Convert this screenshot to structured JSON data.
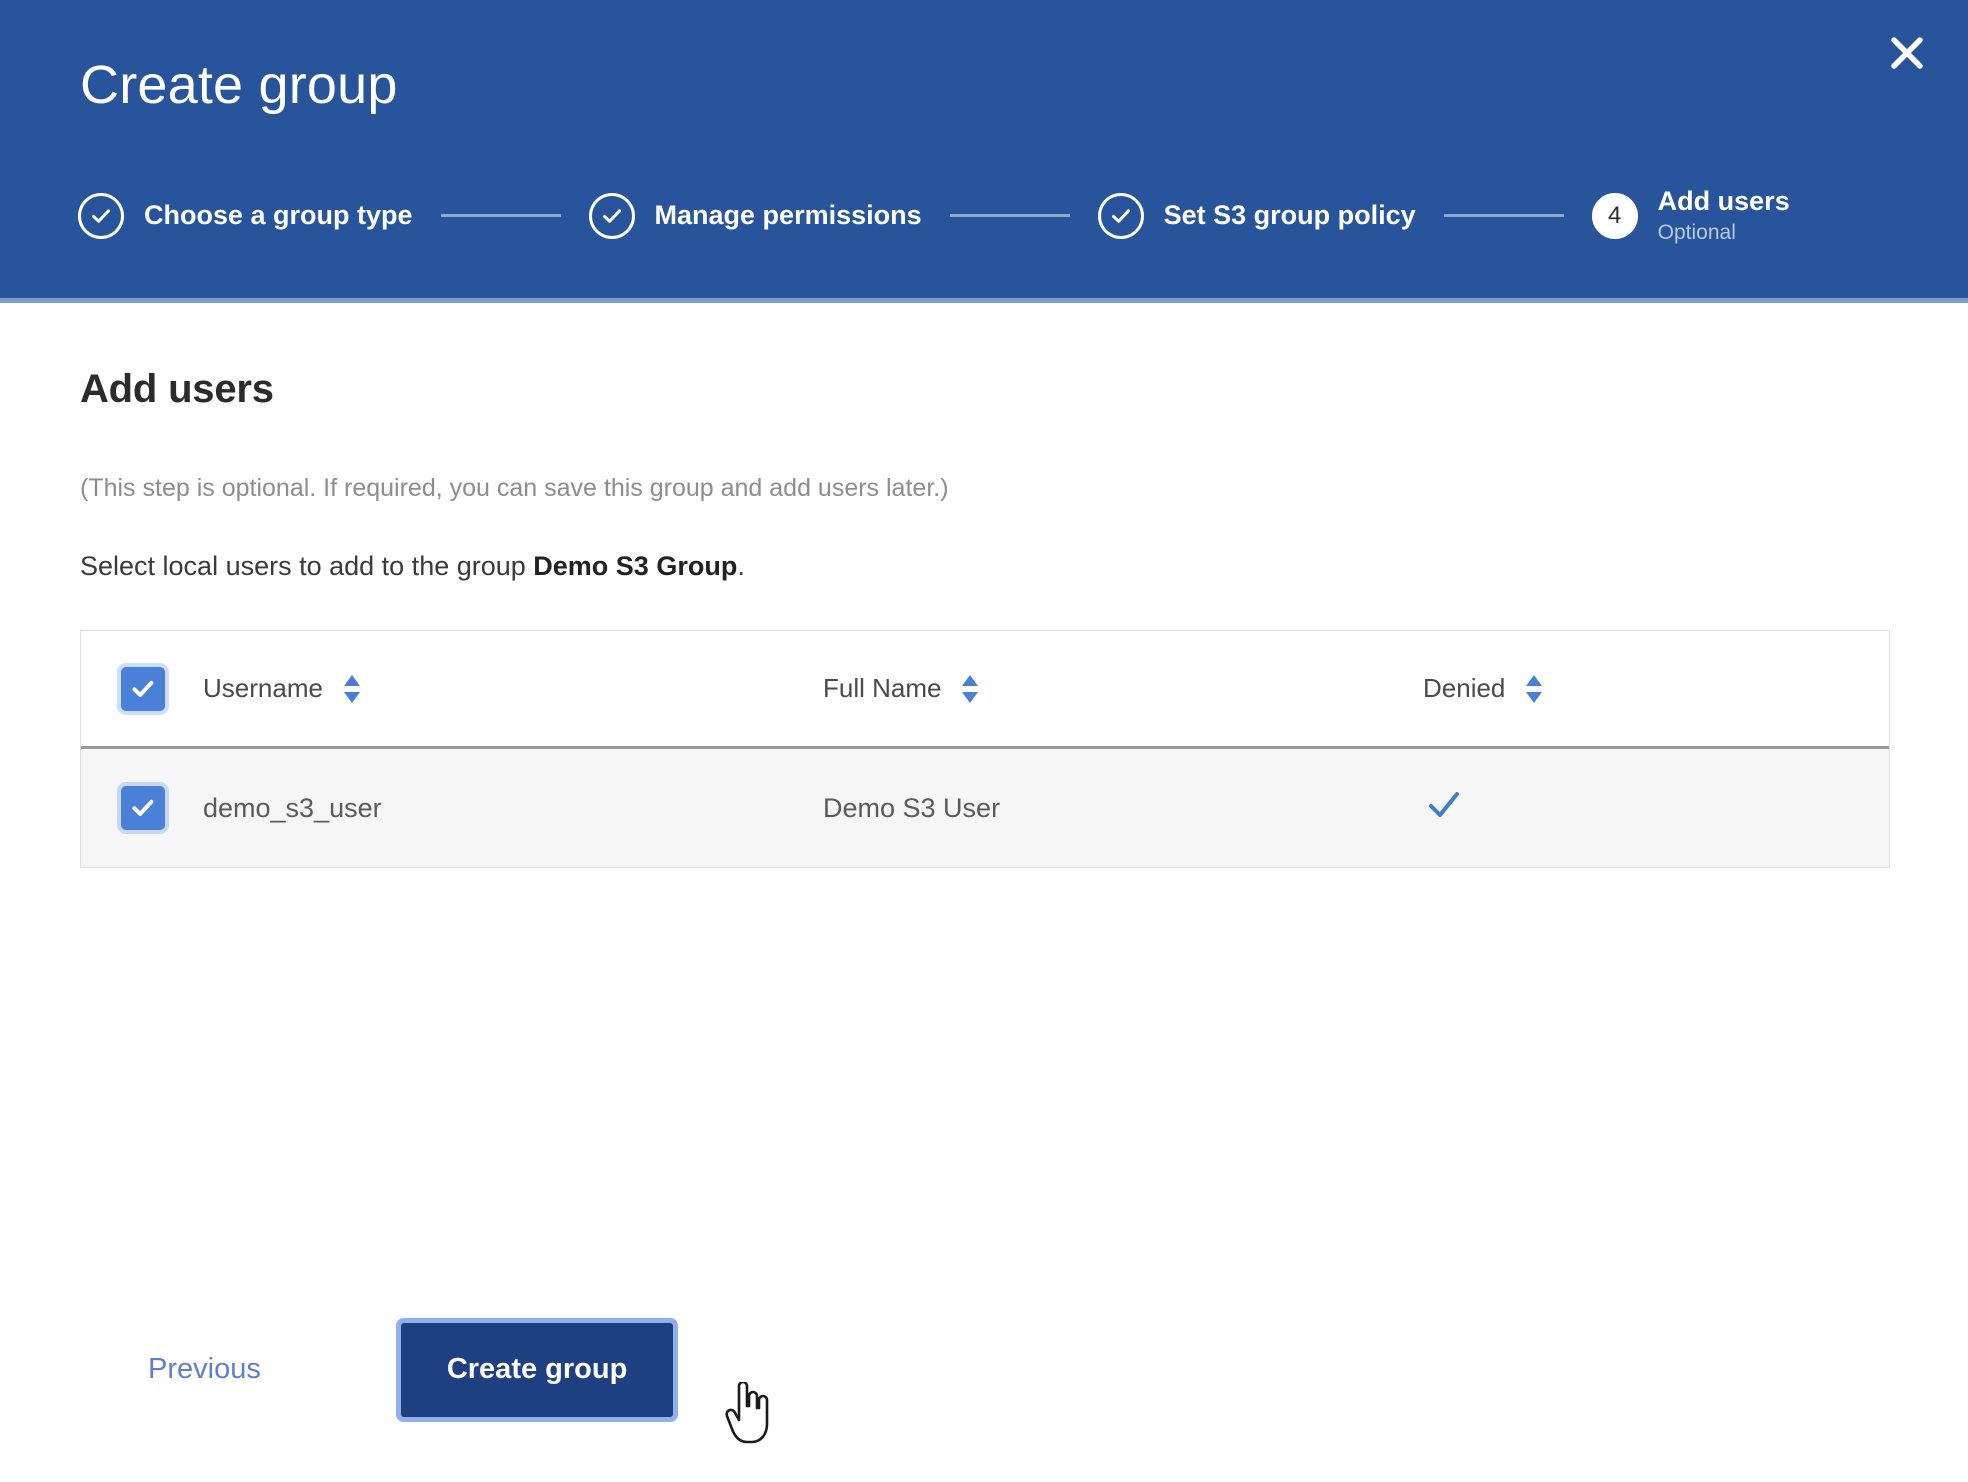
{
  "header": {
    "title": "Create group",
    "close_icon": "close-icon",
    "steps": [
      {
        "label": "Choose a group type",
        "sub": "",
        "state": "done",
        "number": "1"
      },
      {
        "label": "Manage permissions",
        "sub": "",
        "state": "done",
        "number": "2"
      },
      {
        "label": "Set S3 group policy",
        "sub": "",
        "state": "done",
        "number": "3"
      },
      {
        "label": "Add users",
        "sub": "Optional",
        "state": "current",
        "number": "4"
      }
    ]
  },
  "main": {
    "heading": "Add users",
    "optional_note": "(This step is optional. If required, you can save this group and add users later.)",
    "select_prefix": "Select local users to add to the group ",
    "group_name": "Demo S3 Group",
    "select_suffix": "."
  },
  "table": {
    "select_all_checked": true,
    "columns": [
      {
        "label": "Username",
        "sortable": true
      },
      {
        "label": "Full Name",
        "sortable": true
      },
      {
        "label": "Denied",
        "sortable": true
      }
    ],
    "rows": [
      {
        "checked": true,
        "username": "demo_s3_user",
        "full_name": "Demo S3 User",
        "denied": true
      }
    ]
  },
  "footer": {
    "previous_label": "Previous",
    "create_label": "Create group"
  },
  "colors": {
    "header_blue": "#27549b",
    "header_rule": "#7e9dd0",
    "primary_button": "#1e3f80",
    "focus_ring": "#8fb0e8",
    "link_blue": "#5e80cc",
    "checkbox_blue": "#4a80d8",
    "sort_icon_blue": "#4a7fd4",
    "denied_check": "#3d7dc9",
    "row_bg": "#f6f6f6",
    "muted_text": "#8d8d8d",
    "step_sub": "#b8c9e4"
  }
}
